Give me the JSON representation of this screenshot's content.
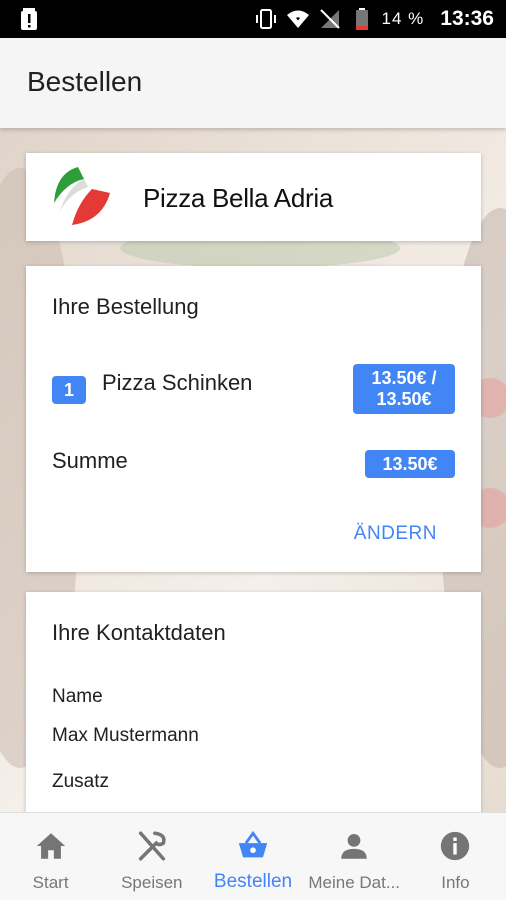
{
  "status_bar": {
    "battery_percent": "14 %",
    "time": "13:36",
    "icons": [
      "battery-alert-icon",
      "vibrate-icon",
      "wifi-icon",
      "no-signal-icon",
      "battery-icon"
    ]
  },
  "header": {
    "title": "Bestellen"
  },
  "restaurant": {
    "name": "Pizza Bella Adria",
    "logo": "italian-flag-logo"
  },
  "order": {
    "heading": "Ihre Bestellung",
    "items": [
      {
        "quantity": "1",
        "name": "Pizza Schinken",
        "price_line1": "13.50€ /",
        "price_line2": "13.50€"
      }
    ],
    "sum_label": "Summe",
    "sum_value": "13.50€",
    "change_label": "ÄNDERN"
  },
  "contact": {
    "heading": "Ihre Kontaktdaten",
    "name_label": "Name",
    "name_value": "Max Mustermann",
    "extra_label": "Zusatz"
  },
  "nav": {
    "active": "Bestellen",
    "items": [
      {
        "label": "Start",
        "icon": "home-icon"
      },
      {
        "label": "Speisen",
        "icon": "cutlery-icon"
      },
      {
        "label": "Bestellen",
        "icon": "basket-icon"
      },
      {
        "label": "Meine Dat...",
        "icon": "person-icon"
      },
      {
        "label": "Info",
        "icon": "info-icon"
      }
    ]
  },
  "colors": {
    "accent": "#4285f4",
    "status_bar": "#000000",
    "header_bg": "#f5f5f5"
  }
}
